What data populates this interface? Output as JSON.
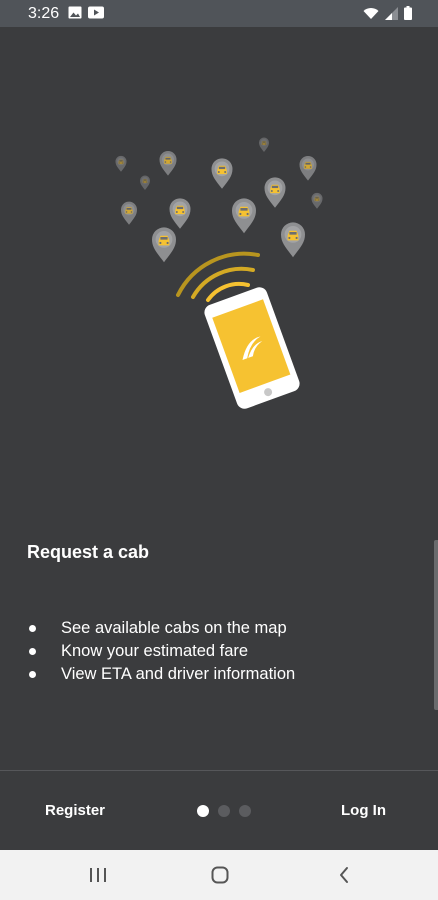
{
  "status_bar": {
    "time": "3:26",
    "left_icons": [
      "image-icon",
      "youtube-icon"
    ],
    "right_icons": [
      "wifi-icon",
      "signal-icon",
      "battery-icon"
    ]
  },
  "illustration": {
    "icons": [
      "taxi-pin-icon",
      "radio-waves-icon",
      "phone-icon",
      "app-logo-icon"
    ]
  },
  "feature": {
    "title": "Request a cab",
    "bullets": [
      "See available cabs on the map",
      "Know your estimated fare",
      "View ETA and driver information"
    ]
  },
  "footer": {
    "register_label": "Register",
    "login_label": "Log In",
    "page_indicator": {
      "count": 3,
      "active": 1
    }
  },
  "nav_bar": {
    "icons": [
      "recents-icon",
      "home-icon",
      "back-icon"
    ]
  },
  "colors": {
    "background": "#3b3c3e",
    "status_bar": "#505459",
    "accent": "#f6c231",
    "pin": "#8e8f91",
    "nav_bar": "#f2f2f2"
  }
}
